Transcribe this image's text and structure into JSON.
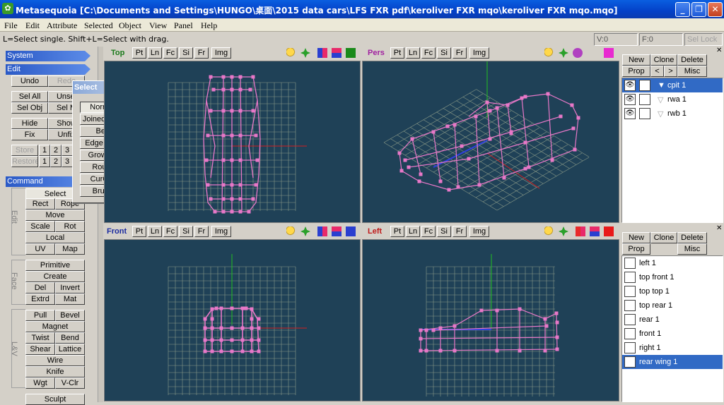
{
  "window": {
    "title": "Metasequoia [C:\\Documents and Settings\\HUNGO\\桌面\\2015 data cars\\LFS FXR pdf\\keroliver FXR mqo\\keroliver FXR mqo.mqo]"
  },
  "menu": [
    "File",
    "Edit",
    "Attribute",
    "Selected",
    "Object",
    "View",
    "Panel",
    "Help"
  ],
  "status": {
    "hint": "L=Select single.  Shift+L=Select with drag.",
    "vertices": "V:0",
    "faces": "F:0",
    "sel_lock": "Sel Lock"
  },
  "left": {
    "system": "System",
    "edit": "Edit",
    "undo": "Undo",
    "redo": "Redo",
    "sel_all": "Sel All",
    "unsel": "Unsel",
    "sel_obj": "Sel Obj",
    "sel_m": "Sel M",
    "hide": "Hide",
    "show": "Show",
    "fix": "Fix",
    "unfix": "Unfix",
    "store": "Store",
    "restore": "Restore",
    "nums": [
      "1",
      "2",
      "3"
    ],
    "command": "Command",
    "select": "Select",
    "rect": "Rect",
    "rope": "Rope",
    "move": "Move",
    "scale": "Scale",
    "rot": "Rot",
    "local": "Local",
    "uv": "UV",
    "map": "Map",
    "edit_label": "Edit",
    "primitive": "Primitive",
    "create": "Create",
    "del": "Del",
    "invert": "Invert",
    "extrd": "Extrd",
    "mat": "Mat",
    "face_label": "Face",
    "pull": "Pull",
    "bevel": "Bevel",
    "magnet": "Magnet",
    "twist": "Twist",
    "bend": "Bend",
    "shear": "Shear",
    "lattice": "Lattice",
    "wire": "Wire",
    "knife": "Knife",
    "wgt": "Wgt",
    "vclr": "V-Clr",
    "lv_label": "L&V",
    "sculpt": "Sculpt"
  },
  "popup": {
    "title": "Select",
    "items": [
      "Normal",
      "Joined face",
      "Belt",
      "Edge loop",
      "Growing",
      "Route",
      "CurObj",
      "Brush"
    ]
  },
  "viewports": {
    "top": {
      "name": "Top"
    },
    "pers": {
      "name": "Pers"
    },
    "front": {
      "name": "Front"
    },
    "left": {
      "name": "Left"
    },
    "buttons": [
      "Pt",
      "Ln",
      "Fc",
      "Si",
      "Fr"
    ],
    "img": "Img"
  },
  "objects": {
    "new": "New",
    "clone": "Clone",
    "delete": "Delete",
    "prop": "Prop",
    "prev": "<",
    "next": ">",
    "misc": "Misc",
    "items": [
      "cpit 1",
      "rwa 1",
      "rwb 1"
    ]
  },
  "materials": {
    "new": "New",
    "clone": "Clone",
    "delete": "Delete",
    "prop": "Prop",
    "misc": "Misc",
    "items": [
      "left 1",
      "top front 1",
      "top top 1",
      "top rear 1",
      "rear 1",
      "front 1",
      "right 1",
      "rear wing 1"
    ]
  },
  "colors": {
    "viewport_bg": "#1f4157",
    "mesh": "#e878c8",
    "grid": "#8a9a88",
    "selection": "#316ac5"
  }
}
